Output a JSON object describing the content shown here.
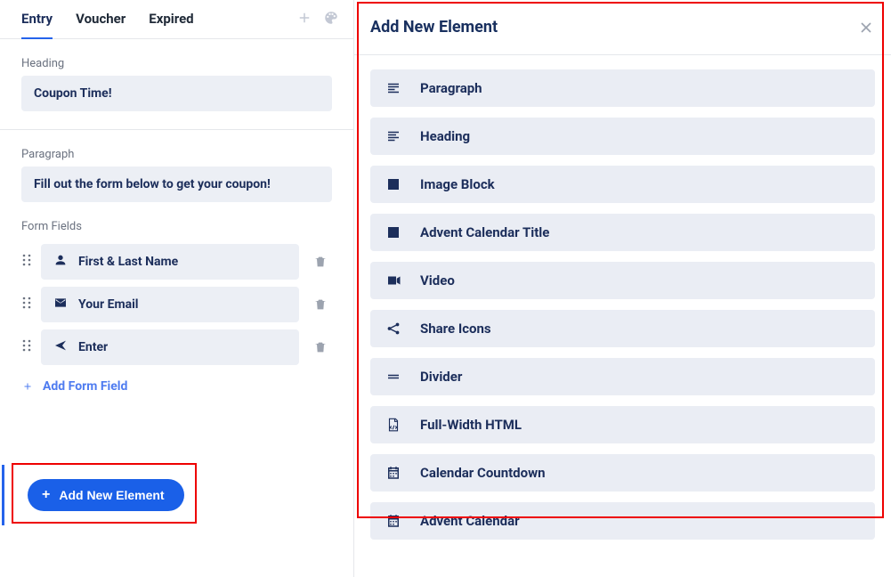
{
  "tabs": {
    "entry": "Entry",
    "voucher": "Voucher",
    "expired": "Expired"
  },
  "sections": {
    "heading_label": "Heading",
    "heading_value": "Coupon Time!",
    "paragraph_label": "Paragraph",
    "paragraph_value": "Fill out the form below to get your coupon!",
    "form_fields_label": "Form Fields"
  },
  "form_fields": [
    {
      "label": "First & Last Name"
    },
    {
      "label": "Your Email"
    },
    {
      "label": "Enter"
    }
  ],
  "actions": {
    "add_form_field": "Add Form Field",
    "add_new_element": "Add New Element"
  },
  "modal": {
    "title": "Add New Element",
    "items": [
      {
        "icon": "paragraph",
        "label": "Paragraph"
      },
      {
        "icon": "heading",
        "label": "Heading"
      },
      {
        "icon": "image",
        "label": "Image Block"
      },
      {
        "icon": "image",
        "label": "Advent Calendar Title"
      },
      {
        "icon": "video",
        "label": "Video"
      },
      {
        "icon": "share",
        "label": "Share Icons"
      },
      {
        "icon": "divider",
        "label": "Divider"
      },
      {
        "icon": "html",
        "label": "Full-Width HTML"
      },
      {
        "icon": "calendar",
        "label": "Calendar Countdown"
      },
      {
        "icon": "calendar",
        "label": "Advent Calendar"
      }
    ]
  }
}
